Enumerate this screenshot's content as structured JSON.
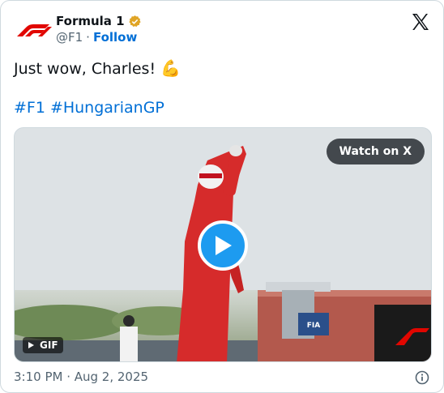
{
  "author": {
    "name": "Formula 1",
    "handle": "@F1",
    "separator": "·",
    "follow_label": "Follow",
    "verified_color": "#e0a526"
  },
  "tweet": {
    "text": "Just wow, Charles!",
    "emoji": "💪",
    "hashtags": [
      "#F1",
      "#HungarianGP"
    ]
  },
  "media": {
    "watch_label": "Watch on X",
    "gif_label": "GIF",
    "play_icon": "play-icon",
    "brand_color": "#e10600"
  },
  "footer": {
    "timestamp": "3:10 PM · Aug 2, 2025",
    "info_icon": "info-icon"
  },
  "colors": {
    "link": "#006fd6",
    "play": "#1d9bf0",
    "text": "#0f1419",
    "muted": "#536471"
  }
}
